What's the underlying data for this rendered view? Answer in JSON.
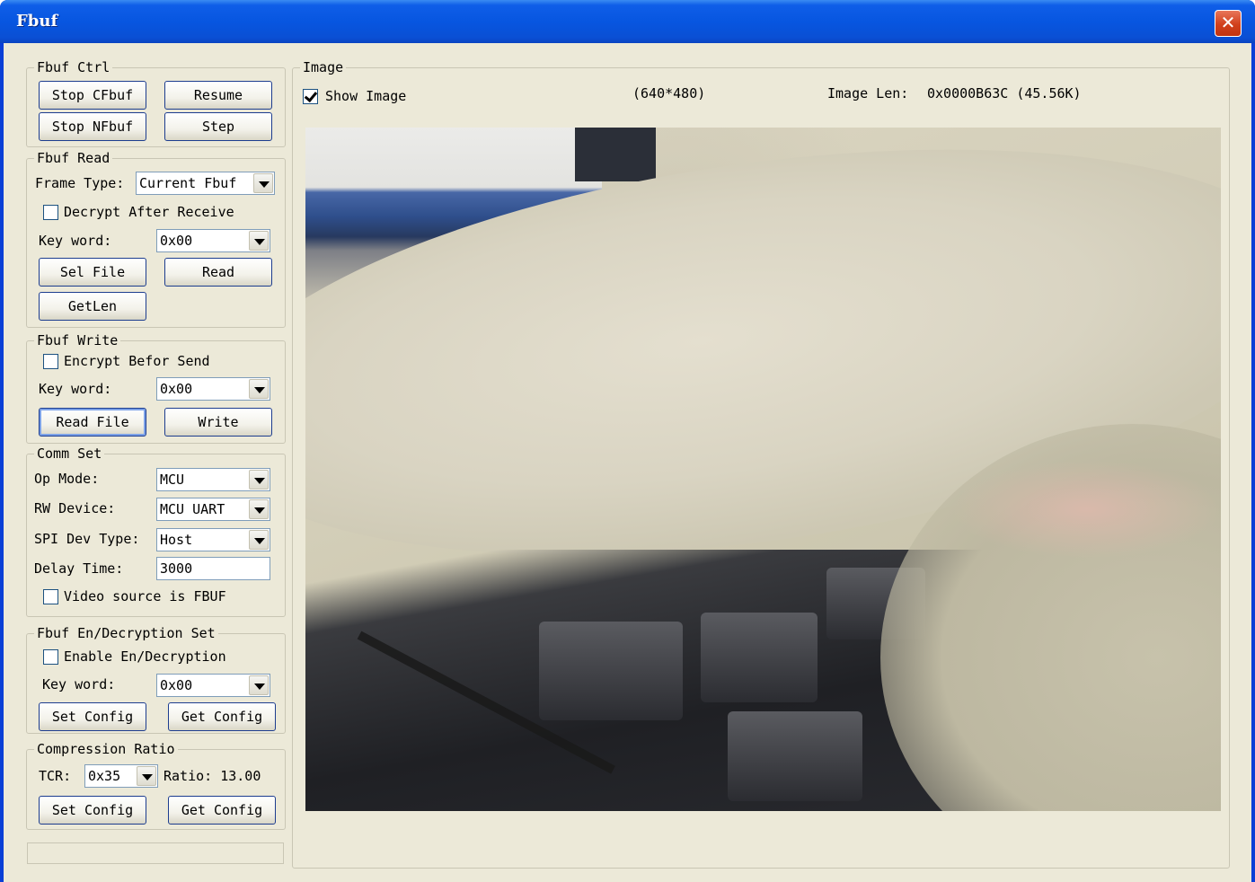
{
  "window": {
    "title": "Fbuf",
    "close_glyph": "✕"
  },
  "fbuf_ctrl": {
    "title": "Fbuf Ctrl",
    "stop_cfbuf": "Stop CFbuf",
    "resume": "Resume",
    "stop_nfbuf": "Stop NFbuf",
    "step": "Step"
  },
  "fbuf_read": {
    "title": "Fbuf Read",
    "frame_type_label": "Frame Type:",
    "frame_type_value": "Current Fbuf",
    "decrypt_label": "Decrypt After Receive",
    "decrypt_checked": false,
    "key_word_label": "Key word:",
    "key_word_value": "0x00",
    "sel_file": "Sel File",
    "read": "Read",
    "getlen": "GetLen"
  },
  "fbuf_write": {
    "title": "Fbuf Write",
    "encrypt_label": "Encrypt Befor Send",
    "encrypt_checked": false,
    "key_word_label": "Key word:",
    "key_word_value": "0x00",
    "read_file": "Read File",
    "write": "Write"
  },
  "comm_set": {
    "title": "Comm Set",
    "op_mode_label": "Op Mode:",
    "op_mode_value": "MCU",
    "rw_device_label": "RW Device:",
    "rw_device_value": "MCU UART",
    "spi_dev_type_label": "SPI Dev Type:",
    "spi_dev_type_value": "Host",
    "delay_time_label": "Delay Time:",
    "delay_time_value": "3000",
    "video_source_label": "Video source is FBUF",
    "video_source_checked": false
  },
  "encryption_set": {
    "title": "Fbuf En/Decryption Set",
    "enable_label": "Enable En/Decryption",
    "enable_checked": false,
    "key_word_label": "Key word:",
    "key_word_value": "0x00",
    "set_config": "Set Config",
    "get_config": "Get Config"
  },
  "compression": {
    "title": "Compression Ratio",
    "tcr_label": "TCR:",
    "tcr_value": "0x35",
    "ratio_text": "Ratio: 13.00",
    "set_config": "Set Config",
    "get_config": "Get Config"
  },
  "image_panel": {
    "title": "Image",
    "show_image_label": "Show Image",
    "show_image_checked": true,
    "resolution": "(640*480)",
    "image_len_label": "Image Len:",
    "image_len_value": "0x0000B63C (45.56K)"
  }
}
